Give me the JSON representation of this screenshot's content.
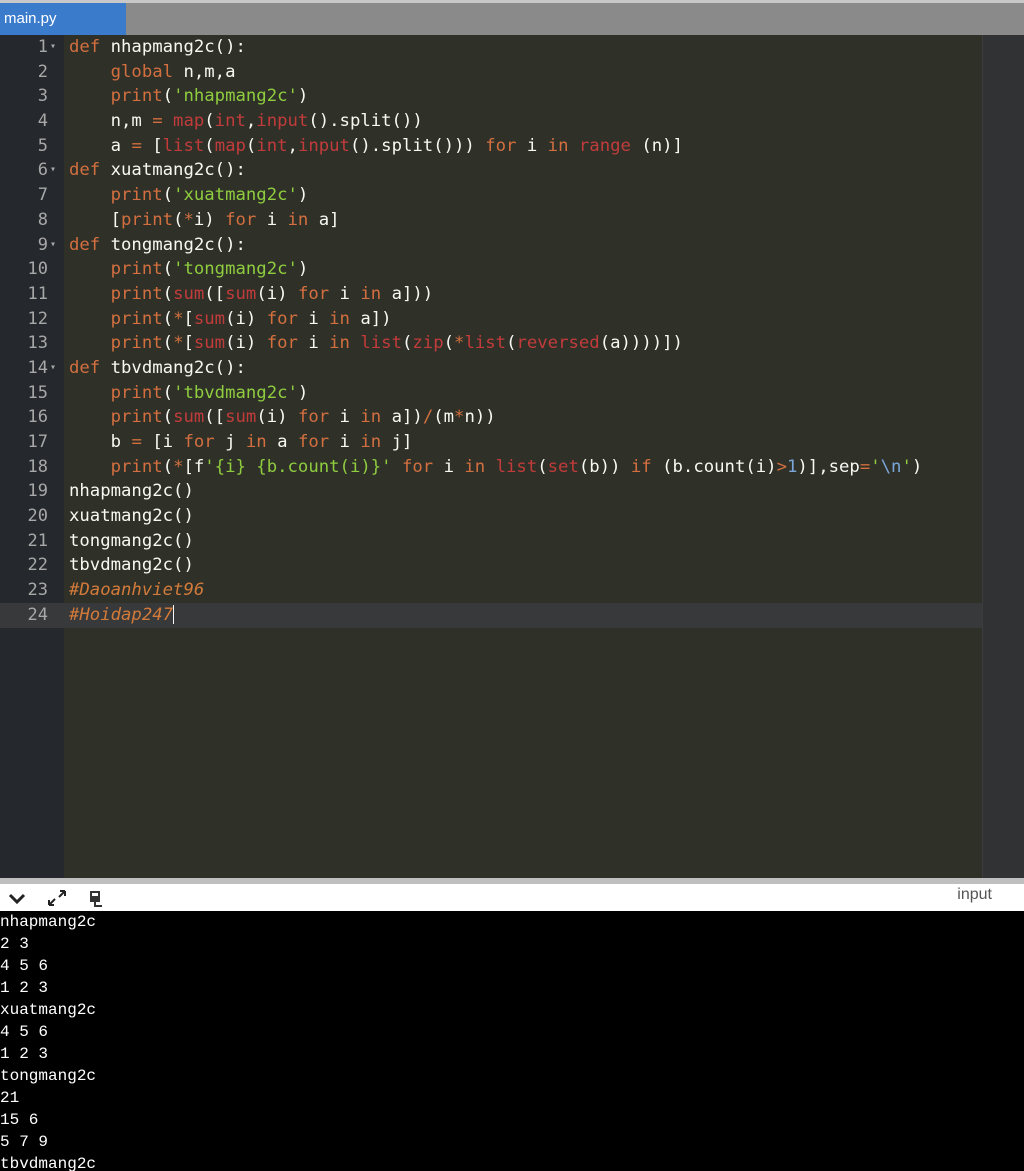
{
  "tab": {
    "label": "main.py"
  },
  "colors": {
    "keyword": "#d36f3f",
    "builtin": "#c23b3b",
    "string": "#8fcd3f",
    "comment": "#d27a3a",
    "plain": "#f8f8f2",
    "number": "#7aa6da"
  },
  "code_lines": [
    {
      "n": "1",
      "fold": true,
      "tokens": [
        [
          "kw",
          "def"
        ],
        [
          "p",
          " nhapmang2c():"
        ]
      ]
    },
    {
      "n": "2",
      "tokens": [
        [
          "p",
          "    "
        ],
        [
          "kw",
          "global"
        ],
        [
          "p",
          " n,m,a"
        ]
      ]
    },
    {
      "n": "3",
      "tokens": [
        [
          "p",
          "    "
        ],
        [
          "kw",
          "print"
        ],
        [
          "p",
          "("
        ],
        [
          "str",
          "'nhapmang2c'"
        ],
        [
          "p",
          ")"
        ]
      ]
    },
    {
      "n": "4",
      "tokens": [
        [
          "p",
          "    n,m "
        ],
        [
          "kw",
          "="
        ],
        [
          "p",
          " "
        ],
        [
          "bi",
          "map"
        ],
        [
          "p",
          "("
        ],
        [
          "bi",
          "int"
        ],
        [
          "p",
          ","
        ],
        [
          "bi",
          "input"
        ],
        [
          "p",
          "().split())"
        ]
      ]
    },
    {
      "n": "5",
      "tokens": [
        [
          "p",
          "    a "
        ],
        [
          "kw",
          "="
        ],
        [
          "p",
          " ["
        ],
        [
          "bi",
          "list"
        ],
        [
          "p",
          "("
        ],
        [
          "bi",
          "map"
        ],
        [
          "p",
          "("
        ],
        [
          "bi",
          "int"
        ],
        [
          "p",
          ","
        ],
        [
          "bi",
          "input"
        ],
        [
          "p",
          "().split())) "
        ],
        [
          "kw",
          "for"
        ],
        [
          "p",
          " i "
        ],
        [
          "kw",
          "in"
        ],
        [
          "p",
          " "
        ],
        [
          "bi",
          "range"
        ],
        [
          "p",
          " (n)]"
        ]
      ]
    },
    {
      "n": "6",
      "fold": true,
      "tokens": [
        [
          "kw",
          "def"
        ],
        [
          "p",
          " xuatmang2c():"
        ]
      ]
    },
    {
      "n": "7",
      "tokens": [
        [
          "p",
          "    "
        ],
        [
          "kw",
          "print"
        ],
        [
          "p",
          "("
        ],
        [
          "str",
          "'xuatmang2c'"
        ],
        [
          "p",
          ")"
        ]
      ]
    },
    {
      "n": "8",
      "tokens": [
        [
          "p",
          "    ["
        ],
        [
          "kw",
          "print"
        ],
        [
          "p",
          "("
        ],
        [
          "kw",
          "*"
        ],
        [
          "p",
          "i) "
        ],
        [
          "kw",
          "for"
        ],
        [
          "p",
          " i "
        ],
        [
          "kw",
          "in"
        ],
        [
          "p",
          " a]"
        ]
      ]
    },
    {
      "n": "9",
      "fold": true,
      "tokens": [
        [
          "kw",
          "def"
        ],
        [
          "p",
          " tongmang2c():"
        ]
      ]
    },
    {
      "n": "10",
      "tokens": [
        [
          "p",
          "    "
        ],
        [
          "kw",
          "print"
        ],
        [
          "p",
          "("
        ],
        [
          "str",
          "'tongmang2c'"
        ],
        [
          "p",
          ")"
        ]
      ]
    },
    {
      "n": "11",
      "tokens": [
        [
          "p",
          "    "
        ],
        [
          "kw",
          "print"
        ],
        [
          "p",
          "("
        ],
        [
          "bi",
          "sum"
        ],
        [
          "p",
          "(["
        ],
        [
          "bi",
          "sum"
        ],
        [
          "p",
          "(i) "
        ],
        [
          "kw",
          "for"
        ],
        [
          "p",
          " i "
        ],
        [
          "kw",
          "in"
        ],
        [
          "p",
          " a]))"
        ]
      ]
    },
    {
      "n": "12",
      "tokens": [
        [
          "p",
          "    "
        ],
        [
          "kw",
          "print"
        ],
        [
          "p",
          "("
        ],
        [
          "kw",
          "*"
        ],
        [
          "p",
          "["
        ],
        [
          "bi",
          "sum"
        ],
        [
          "p",
          "(i) "
        ],
        [
          "kw",
          "for"
        ],
        [
          "p",
          " i "
        ],
        [
          "kw",
          "in"
        ],
        [
          "p",
          " a])"
        ]
      ]
    },
    {
      "n": "13",
      "tokens": [
        [
          "p",
          "    "
        ],
        [
          "kw",
          "print"
        ],
        [
          "p",
          "("
        ],
        [
          "kw",
          "*"
        ],
        [
          "p",
          "["
        ],
        [
          "bi",
          "sum"
        ],
        [
          "p",
          "(i) "
        ],
        [
          "kw",
          "for"
        ],
        [
          "p",
          " i "
        ],
        [
          "kw",
          "in"
        ],
        [
          "p",
          " "
        ],
        [
          "bi",
          "list"
        ],
        [
          "p",
          "("
        ],
        [
          "bi",
          "zip"
        ],
        [
          "p",
          "("
        ],
        [
          "kw",
          "*"
        ],
        [
          "bi",
          "list"
        ],
        [
          "p",
          "("
        ],
        [
          "bi",
          "reversed"
        ],
        [
          "p",
          "(a))))])"
        ]
      ]
    },
    {
      "n": "14",
      "fold": true,
      "tokens": [
        [
          "kw",
          "def"
        ],
        [
          "p",
          " tbvdmang2c():"
        ]
      ]
    },
    {
      "n": "15",
      "tokens": [
        [
          "p",
          "    "
        ],
        [
          "kw",
          "print"
        ],
        [
          "p",
          "("
        ],
        [
          "str",
          "'tbvdmang2c'"
        ],
        [
          "p",
          ")"
        ]
      ]
    },
    {
      "n": "16",
      "tokens": [
        [
          "p",
          "    "
        ],
        [
          "kw",
          "print"
        ],
        [
          "p",
          "("
        ],
        [
          "bi",
          "sum"
        ],
        [
          "p",
          "(["
        ],
        [
          "bi",
          "sum"
        ],
        [
          "p",
          "(i) "
        ],
        [
          "kw",
          "for"
        ],
        [
          "p",
          " i "
        ],
        [
          "kw",
          "in"
        ],
        [
          "p",
          " a])"
        ],
        [
          "kw",
          "/"
        ],
        [
          "p",
          "(m"
        ],
        [
          "kw",
          "*"
        ],
        [
          "p",
          "n))"
        ]
      ]
    },
    {
      "n": "17",
      "tokens": [
        [
          "p",
          "    b "
        ],
        [
          "kw",
          "="
        ],
        [
          "p",
          " [i "
        ],
        [
          "kw",
          "for"
        ],
        [
          "p",
          " j "
        ],
        [
          "kw",
          "in"
        ],
        [
          "p",
          " a "
        ],
        [
          "kw",
          "for"
        ],
        [
          "p",
          " i "
        ],
        [
          "kw",
          "in"
        ],
        [
          "p",
          " j]"
        ]
      ]
    },
    {
      "n": "18",
      "tokens": [
        [
          "p",
          "    "
        ],
        [
          "kw",
          "print"
        ],
        [
          "p",
          "("
        ],
        [
          "kw",
          "*"
        ],
        [
          "p",
          "[f"
        ],
        [
          "str",
          "'{i} {b.count(i)}'"
        ],
        [
          "p",
          " "
        ],
        [
          "kw",
          "for"
        ],
        [
          "p",
          " i "
        ],
        [
          "kw",
          "in"
        ],
        [
          "p",
          " "
        ],
        [
          "bi",
          "list"
        ],
        [
          "p",
          "("
        ],
        [
          "bi",
          "set"
        ],
        [
          "p",
          "(b)) "
        ],
        [
          "kw",
          "if"
        ],
        [
          "p",
          " (b.count(i)"
        ],
        [
          "kw",
          ">"
        ],
        [
          "num",
          "1"
        ],
        [
          "p",
          ")],sep"
        ],
        [
          "kw",
          "="
        ],
        [
          "str",
          "'"
        ],
        [
          "num",
          "\\n"
        ],
        [
          "str",
          "'"
        ],
        [
          "p",
          ")"
        ]
      ]
    },
    {
      "n": "19",
      "tokens": [
        [
          "p",
          "nhapmang2c()"
        ]
      ]
    },
    {
      "n": "20",
      "tokens": [
        [
          "p",
          "xuatmang2c()"
        ]
      ]
    },
    {
      "n": "21",
      "tokens": [
        [
          "p",
          "tongmang2c()"
        ]
      ]
    },
    {
      "n": "22",
      "tokens": [
        [
          "p",
          "tbvdmang2c()"
        ]
      ]
    },
    {
      "n": "23",
      "tokens": [
        [
          "cm",
          "#Daoanhviet96"
        ]
      ]
    },
    {
      "n": "24",
      "active": true,
      "caret": true,
      "tokens": [
        [
          "cm",
          "#Hoidap247"
        ]
      ]
    }
  ],
  "console": {
    "input_label": "input",
    "output": [
      "nhapmang2c",
      "2 3",
      "4 5 6",
      "1 2 3",
      "xuatmang2c",
      "4 5 6",
      "1 2 3",
      "tongmang2c",
      "21",
      "15 6",
      "5 7 9",
      "tbvdmang2c"
    ]
  },
  "icons": [
    "chevron-down-icon",
    "expand-icon",
    "clear-console-icon"
  ]
}
